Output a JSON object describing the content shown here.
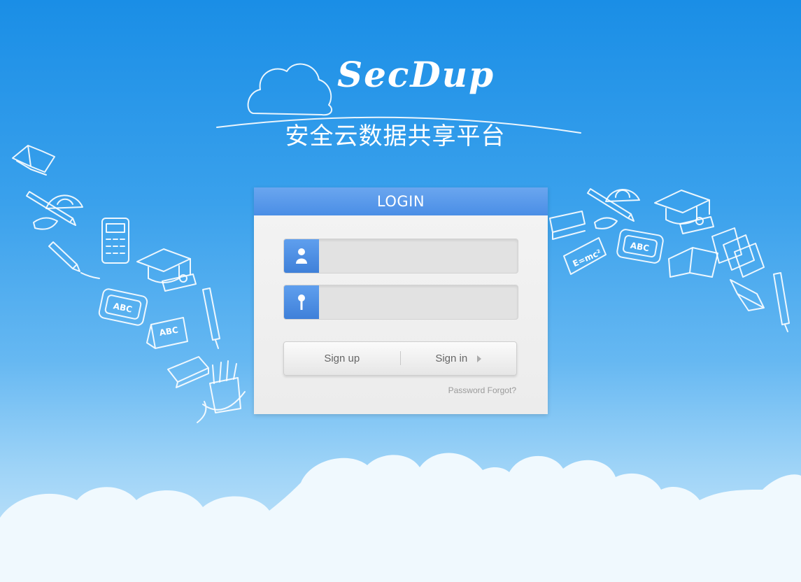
{
  "brand": {
    "name": "SecDup",
    "subtitle": "安全云数据共享平台"
  },
  "login": {
    "title": "LOGIN",
    "username": {
      "value": "",
      "placeholder": "",
      "icon": "user-icon"
    },
    "password": {
      "value": "",
      "placeholder": "",
      "icon": "key-icon"
    },
    "sign_up_label": "Sign up",
    "sign_in_label": "Sign in",
    "forgot_label": "Password Forgot?"
  },
  "doodles": {
    "left_abc_pencil_case": "ABC",
    "left_abc_book": "ABC",
    "right_abc_pencil_case": "ABC",
    "right_formula_card": "E=mc²"
  },
  "colors": {
    "accent": "#4a8ee6",
    "sky_top": "#1a8ee6",
    "sky_bottom": "#cfe9fb",
    "cloud": "#f0f9fe"
  }
}
